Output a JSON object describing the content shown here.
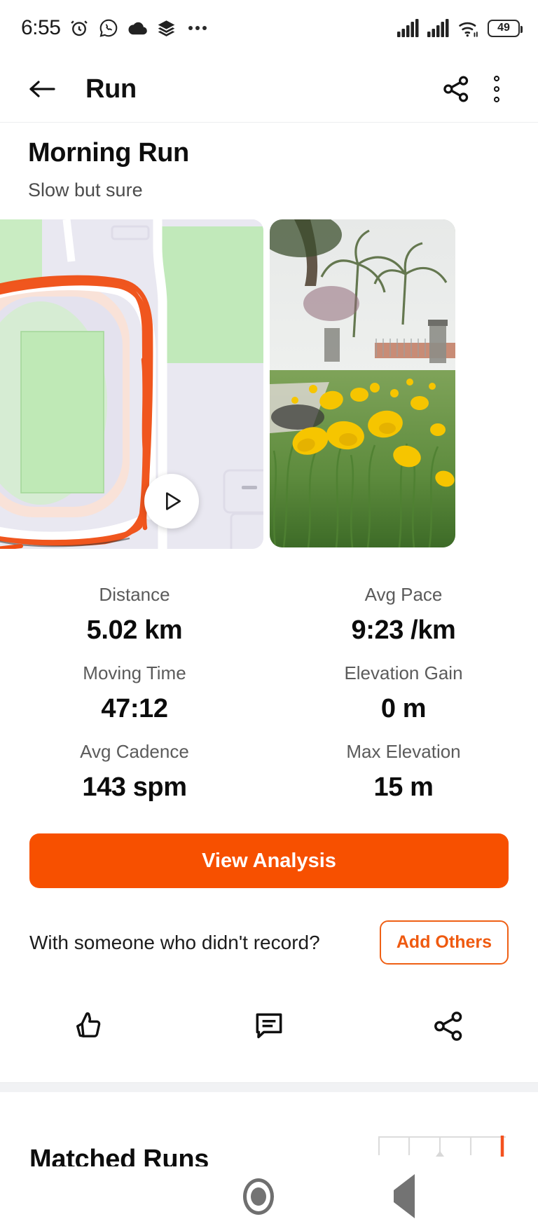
{
  "status_bar": {
    "time": "6:55",
    "battery_percent": "49",
    "left_icons": [
      "alarm-icon",
      "whatsapp-icon",
      "cloud-icon",
      "layers-icon",
      "more-dots-icon"
    ],
    "right_icons": [
      "signal-bars-icon",
      "signal-bars-2-icon",
      "wifi-icon",
      "battery-icon"
    ]
  },
  "app_bar": {
    "back_icon": "back-arrow-icon",
    "title": "Run",
    "share_icon": "share-icon",
    "overflow_icon": "more-vertical-icon"
  },
  "activity": {
    "title": "Morning Run",
    "description": "Slow but sure",
    "map": {
      "route_color": "#f04e13",
      "play_icon": "play-triangle-icon"
    },
    "photo": {
      "alt": "photo-thumbnail"
    }
  },
  "stats": [
    {
      "label": "Distance",
      "value": "5.02 km"
    },
    {
      "label": "Avg Pace",
      "value": "9:23 /km"
    },
    {
      "label": "Moving Time",
      "value": "47:12"
    },
    {
      "label": "Elevation Gain",
      "value": "0 m"
    },
    {
      "label": "Avg Cadence",
      "value": "143 spm"
    },
    {
      "label": "Max Elevation",
      "value": "15 m"
    }
  ],
  "cta": {
    "label": "View Analysis",
    "color": "#f75000"
  },
  "add_others": {
    "prompt": "With someone who didn't record?",
    "button_label": "Add Others",
    "accent": "#ef5a10"
  },
  "social_actions": [
    {
      "name": "like",
      "icon": "thumbs-up-icon"
    },
    {
      "name": "comment",
      "icon": "comment-icon"
    },
    {
      "name": "share",
      "icon": "share-icon"
    }
  ],
  "matched_runs": {
    "title": "Matched Runs",
    "scale_marker_color": "#f4511e"
  },
  "nav_bar": {
    "recents_icon": "square-icon",
    "home_icon": "circle-icon",
    "back_icon": "triangle-back-icon"
  }
}
